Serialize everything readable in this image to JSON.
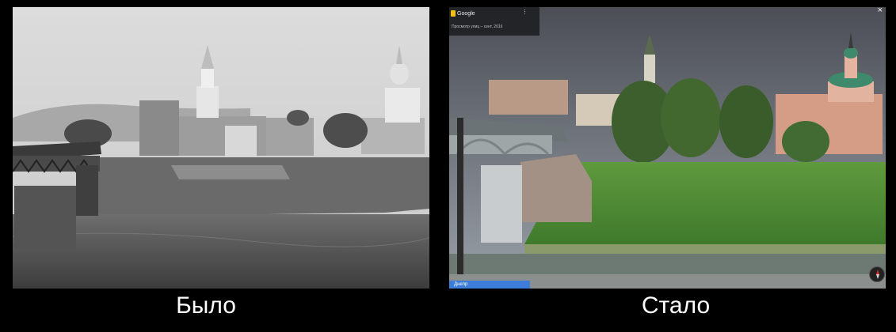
{
  "captions": {
    "before": "Было",
    "after": "Стало"
  },
  "street_view": {
    "title": "Google",
    "subtitle": "Просмотр улиц – сент. 2016",
    "footer_label": "Днепр"
  }
}
